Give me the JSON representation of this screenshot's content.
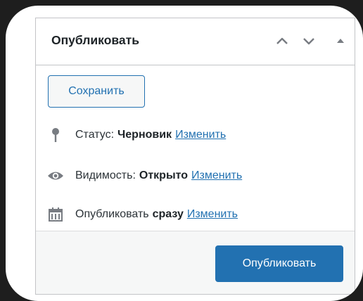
{
  "panel": {
    "title": "Опубликовать",
    "controls": [
      "move-up-icon",
      "move-down-icon",
      "toggle-panel-icon"
    ]
  },
  "actions": {
    "save_label": "Сохранить",
    "publish_label": "Опубликовать"
  },
  "status": {
    "icon": "pin-icon",
    "label": "Статус:",
    "value": "Черновик",
    "edit_link": "Изменить"
  },
  "visibility": {
    "icon": "eye-icon",
    "label": "Видимость:",
    "value": "Открыто",
    "edit_link": "Изменить"
  },
  "schedule": {
    "icon": "calendar-icon",
    "label": "Опубликовать",
    "value": "сразу",
    "edit_link": "Изменить"
  },
  "colors": {
    "accent": "#2271b1",
    "border": "#c3c4c7",
    "background": "#1e1e1e",
    "footer": "#f6f7f7"
  }
}
